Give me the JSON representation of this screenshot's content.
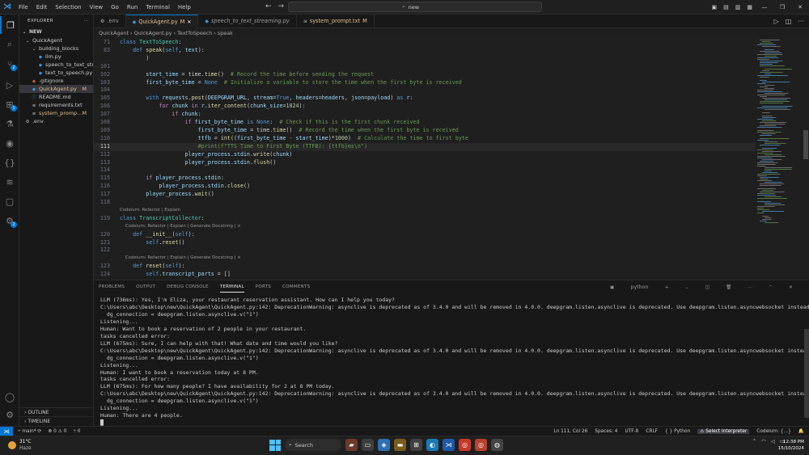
{
  "menu": [
    "File",
    "Edit",
    "Selection",
    "View",
    "Go",
    "Run",
    "Terminal",
    "Help"
  ],
  "search": {
    "placeholder": "new"
  },
  "sidebar": {
    "title": "EXPLORER",
    "root": "NEW",
    "items": [
      {
        "label": "QuickAgent",
        "marker": "",
        "indent": 6,
        "kind": "folder-open"
      },
      {
        "label": "building_blocks",
        "marker": "",
        "indent": 14,
        "kind": "folder-open"
      },
      {
        "label": "llm.py",
        "marker": "",
        "indent": 22,
        "kind": "py"
      },
      {
        "label": "speech_to_text_str...",
        "marker": "",
        "indent": 22,
        "kind": "py"
      },
      {
        "label": "text_to_speech.py",
        "marker": "",
        "indent": 22,
        "kind": "py"
      },
      {
        "label": ".gitignore",
        "marker": "",
        "indent": 14,
        "kind": "git"
      },
      {
        "label": "QuickAgent.py",
        "marker": "M",
        "indent": 14,
        "kind": "py",
        "selected": true,
        "modified": true
      },
      {
        "label": "README.md",
        "marker": "",
        "indent": 14,
        "kind": "md"
      },
      {
        "label": "requirements.txt",
        "marker": "",
        "indent": 14,
        "kind": "txt"
      },
      {
        "label": "system_promp...",
        "marker": "M",
        "indent": 14,
        "kind": "txt",
        "modified": true
      },
      {
        "label": ".env",
        "marker": "",
        "indent": 6,
        "kind": "env"
      }
    ],
    "outline": "OUTLINE",
    "timeline": "TIMELINE"
  },
  "tabs": [
    {
      "label": ".env",
      "marker": "",
      "active": false,
      "italic": false
    },
    {
      "label": "QuickAgent.py",
      "marker": "M",
      "active": true,
      "italic": false
    },
    {
      "label": "speech_to_text_streaming.py",
      "marker": "",
      "active": false,
      "italic": true
    },
    {
      "label": "system_prompt.txt",
      "marker": "M",
      "active": false,
      "italic": false
    }
  ],
  "breadcrumb": "QuickAgent  ›  QuickAgent.py  ›  TextToSpeech  ›  speak",
  "editor_lines": [
    {
      "n": "71",
      "t": "class TextToSpeech:"
    },
    {
      "n": "83",
      "t": "    def speak(self, text):"
    },
    {
      "n": "",
      "t": "        )"
    },
    {
      "n": "101",
      "t": ""
    },
    {
      "n": "102",
      "t": "        start_time = time.time()  # Record the time before sending the request"
    },
    {
      "n": "103",
      "t": "        first_byte_time = None  # Initialize a variable to store the time when the first byte is received"
    },
    {
      "n": "104",
      "t": ""
    },
    {
      "n": "105",
      "t": "        with requests.post(DEEPGRAM_URL, stream=True, headers=headers, json=payload) as r:"
    },
    {
      "n": "106",
      "t": "            for chunk in r.iter_content(chunk_size=1024):"
    },
    {
      "n": "107",
      "t": "                if chunk:"
    },
    {
      "n": "108",
      "t": "                    if first_byte_time is None:  # Check if this is the first chunk received"
    },
    {
      "n": "109",
      "t": "                        first_byte_time = time.time()  # Record the time when the first byte is received"
    },
    {
      "n": "110",
      "t": "                        ttfb = int((first_byte_time - start_time)*1000)  # Calculate the time to first byte"
    },
    {
      "n": "111",
      "t": "                        #print(f\"TTS Time to First Byte (TTFB): {ttfb}ms\\n\")"
    },
    {
      "n": "112",
      "t": "                    player_process.stdin.write(chunk)"
    },
    {
      "n": "113",
      "t": "                    player_process.stdin.flush()"
    },
    {
      "n": "114",
      "t": ""
    },
    {
      "n": "115",
      "t": "        if player_process.stdin:"
    },
    {
      "n": "116",
      "t": "            player_process.stdin.close()"
    },
    {
      "n": "117",
      "t": "        player_process.wait()"
    },
    {
      "n": "118",
      "t": ""
    },
    {
      "n": "",
      "t": "Codeium: Refactor | Explain",
      "lens": true
    },
    {
      "n": "119",
      "t": "class TranscriptCollector:"
    },
    {
      "n": "",
      "t": "    Codeium: Refactor | Explain | Generate Docstring | ×",
      "lens": true
    },
    {
      "n": "120",
      "t": "    def __init__(self):"
    },
    {
      "n": "121",
      "t": "        self.reset()"
    },
    {
      "n": "122",
      "t": ""
    },
    {
      "n": "",
      "t": "    Codeium: Refactor | Explain | Generate Docstring | ×",
      "lens": true
    },
    {
      "n": "123",
      "t": "    def reset(self):"
    },
    {
      "n": "124",
      "t": "        self.transcript_parts = []"
    }
  ],
  "panel": {
    "tabs": [
      "PROBLEMS",
      "OUTPUT",
      "DEBUG CONSOLE",
      "TERMINAL",
      "PORTS",
      "COMMENTS"
    ],
    "active": "TERMINAL",
    "shell": "python",
    "lines": [
      "LLM (736ms): Yes, I'm Eliza, your restaurant reservation assistant. How can I help you today?",
      "C:\\Users\\abc\\Desktop\\new\\QuickAgent\\QuickAgent.py:142: DeprecationWarning: asynclive is deprecated as of 3.4.0 and will be removed in 4.0.0. deepgram.listen.asynclive is deprecated. Use deepgram.listen.asyncwebsocket instead.",
      "  dg_connection = deepgram.listen.asynclive.v(\"1\")",
      "Listening...",
      "Human: Want to book a reservation of 2 people in your restaurant.",
      "tasks cancelled error:",
      "LLM (675ms): Sure, I can help with that! What date and time would you like?",
      "C:\\Users\\abc\\Desktop\\new\\QuickAgent\\QuickAgent.py:142: DeprecationWarning: asynclive is deprecated as of 3.4.0 and will be removed in 4.0.0. deepgram.listen.asynclive is deprecated. Use deepgram.listen.asyncwebsocket instead.",
      "  dg_connection = deepgram.listen.asynclive.v(\"1\")",
      "Listening...",
      "Human: I want to book a reservation today at 8 PM.",
      "tasks cancelled error:",
      "LLM (675ms): For how many people? I have availability for 2 at 8 PM today.",
      "C:\\Users\\abc\\Desktop\\new\\QuickAgent\\QuickAgent.py:142: DeprecationWarning: asynclive is deprecated as of 3.4.0 and will be removed in 4.0.0. deepgram.listen.asynclive is deprecated. Use deepgram.listen.asyncwebsocket instead.",
      "  dg_connection = deepgram.listen.asynclive.v(\"1\")",
      "Listening...",
      "Human: There are 4 people.",
      "█"
    ]
  },
  "status": {
    "branch": "main*",
    "errors": "⊗ 0 ⚠ 0",
    "ports": "⑂ 0",
    "position": "Ln 111, Col 26",
    "spaces": "Spaces: 4",
    "encoding": "UTF-8",
    "eol": "CRLF",
    "language": "Python",
    "interpreter": "Select Interpreter",
    "codeium": "Codeium: {...}"
  },
  "taskbar": {
    "temp": "31°C",
    "weather": "Haze",
    "search": "Search",
    "time": "12:38 PM",
    "date": "15/10/2024"
  },
  "colors": {
    "accent": "#0078d4",
    "modified": "#e2c08d",
    "keyword": "#569cd6",
    "string": "#ce9178",
    "comment": "#6a9955"
  }
}
